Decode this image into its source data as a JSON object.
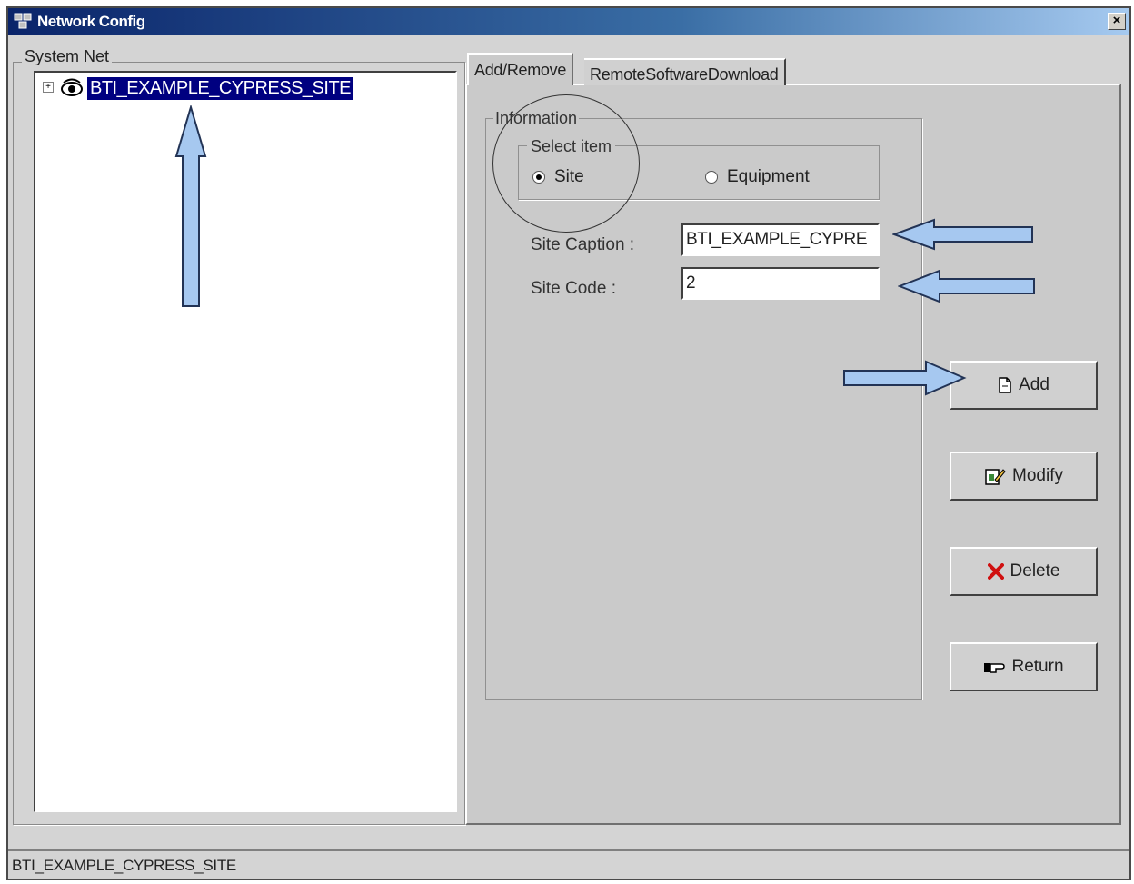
{
  "window": {
    "title": "Network Config",
    "close_glyph": "×"
  },
  "system_net": {
    "group_label": "System Net",
    "tree_root": {
      "expander": "+",
      "icon": "eye-icon",
      "label": "BTI_EXAMPLE_CYPRESS_SITE"
    }
  },
  "tabs": [
    {
      "label": "Add/Remove",
      "active": true
    },
    {
      "label": "RemoteSoftwareDownload",
      "active": false
    }
  ],
  "information": {
    "group_label": "Information",
    "select_item": {
      "group_label": "Select item",
      "options": [
        {
          "label": "Site",
          "checked": true
        },
        {
          "label": "Equipment",
          "checked": false
        }
      ]
    },
    "site_caption": {
      "label": "Site Caption :",
      "value": "BTI_EXAMPLE_CYPRE"
    },
    "site_code": {
      "label": "Site Code :",
      "value": "2"
    }
  },
  "buttons": {
    "add": {
      "label": "Add",
      "icon": "document-icon"
    },
    "modify": {
      "label": "Modify",
      "icon": "edit-icon"
    },
    "delete": {
      "label": "Delete",
      "icon": "delete-x-icon"
    },
    "return": {
      "label": "Return",
      "icon": "return-hand-icon"
    }
  },
  "status_bar": {
    "text": "BTI_EXAMPLE_CYPRESS_SITE"
  },
  "colors": {
    "titlebar": "#0a246a",
    "selection": "#000080",
    "annotation_arrow": "#a6c8f0"
  }
}
